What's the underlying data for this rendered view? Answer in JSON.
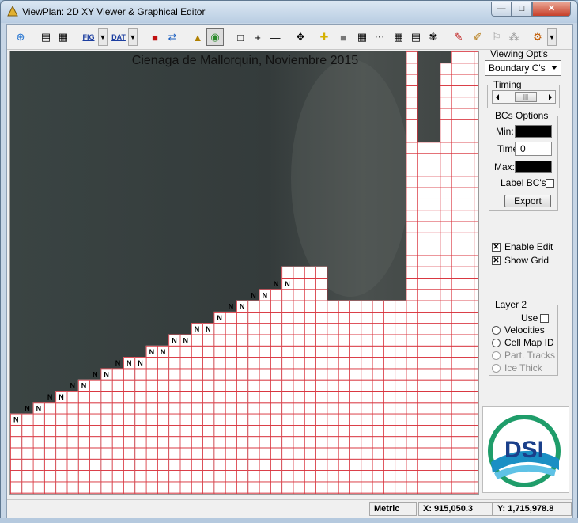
{
  "window": {
    "title": "ViewPlan: 2D XY Viewer & Graphical Editor",
    "controls": {
      "minimize": "—",
      "maximize": "□",
      "close": "✕"
    }
  },
  "toolbar": {
    "fig_label": "FIG",
    "dat_label": "DAT"
  },
  "map": {
    "title": "Cienaga de Mallorquin, Noviembre 2015",
    "grid_color": "#d8303a",
    "water_color": "#3a4443",
    "node_marker": "N"
  },
  "panel": {
    "viewing_opts_label": "Viewing Opt's",
    "viewing_selected": "Boundary C's",
    "timing_label": "Timing",
    "slider_thumb": "|||",
    "bcs_options_label": "BCs Options",
    "min_label": "Min:",
    "time_label": "Time:",
    "time_value": "0",
    "max_label": "Max:",
    "label_bcs": "Label BC's",
    "export_label": "Export",
    "enable_edit": "Enable Edit",
    "show_grid": "Show Grid",
    "layer2_label": "Layer 2",
    "use_label": "Use",
    "velocities": "Velocities",
    "cell_map_id": "Cell Map ID",
    "part_tracks": "Part. Tracks",
    "ice_thick": "Ice Thick",
    "logo_text": "DSI"
  },
  "status": {
    "units": "Metric",
    "x": "X: 915,050.3",
    "y": "Y: 1,715,978.8"
  }
}
